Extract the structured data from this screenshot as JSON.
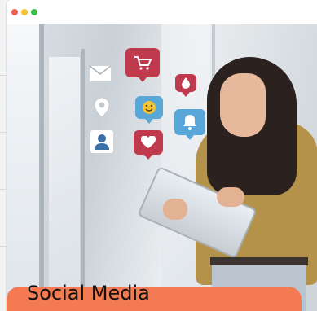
{
  "window": {
    "controls": [
      "close",
      "minimize",
      "maximize"
    ],
    "control_colors": {
      "close": "#f25f50",
      "minimize": "#f7c22b",
      "maximize": "#3fbf4a"
    }
  },
  "hero": {
    "icons": [
      "mail-icon",
      "location-pin-icon",
      "user-icon",
      "cart-icon",
      "emoji-icon",
      "heart-icon",
      "water-drop-icon",
      "bell-icon"
    ],
    "caption": "Social Media",
    "caption_color": "#f47a52"
  }
}
